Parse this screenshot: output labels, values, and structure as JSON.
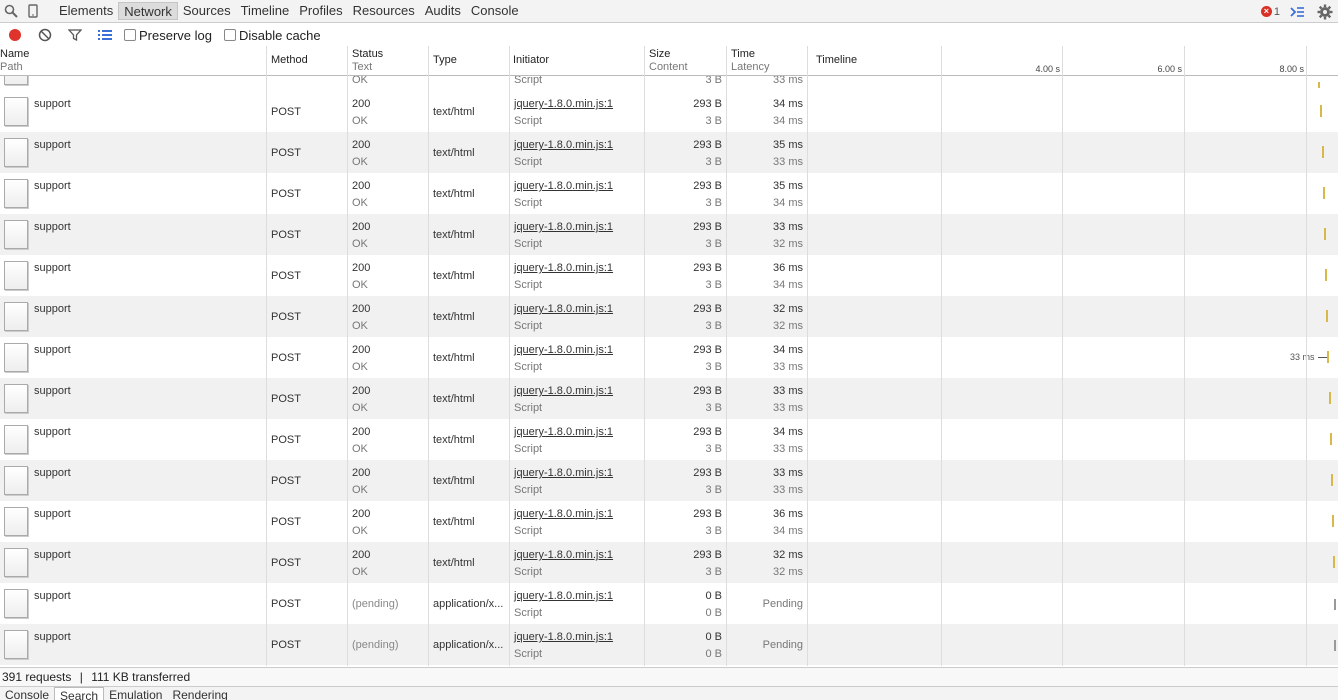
{
  "tabs": [
    "Elements",
    "Network",
    "Sources",
    "Timeline",
    "Profiles",
    "Resources",
    "Audits",
    "Console"
  ],
  "active_tab": "Network",
  "error_count": "1",
  "toolbar": {
    "preserve_log": "Preserve log",
    "disable_cache": "Disable cache"
  },
  "columns": {
    "name": "Name",
    "path": "Path",
    "method": "Method",
    "status": "Status",
    "text": "Text",
    "type": "Type",
    "initiator": "Initiator",
    "size": "Size",
    "content": "Content",
    "time": "Time",
    "latency": "Latency",
    "timeline": "Timeline"
  },
  "timeline_ticks": [
    "4.00 s",
    "6.00 s",
    "8.00 s"
  ],
  "partial_row": {
    "status_text": "OK",
    "initiator_type": "Script",
    "content": "3 B",
    "latency": "33 ms"
  },
  "rows": [
    {
      "name": "support",
      "method": "POST",
      "status": "200",
      "text": "OK",
      "type": "text/html",
      "initiator": "jquery-1.8.0.min.js:1",
      "init_type": "Script",
      "size": "293 B",
      "content": "3 B",
      "time": "34 ms",
      "latency": "34 ms",
      "bar": 1320
    },
    {
      "name": "support",
      "method": "POST",
      "status": "200",
      "text": "OK",
      "type": "text/html",
      "initiator": "jquery-1.8.0.min.js:1",
      "init_type": "Script",
      "size": "293 B",
      "content": "3 B",
      "time": "35 ms",
      "latency": "33 ms",
      "bar": 1322
    },
    {
      "name": "support",
      "method": "POST",
      "status": "200",
      "text": "OK",
      "type": "text/html",
      "initiator": "jquery-1.8.0.min.js:1",
      "init_type": "Script",
      "size": "293 B",
      "content": "3 B",
      "time": "35 ms",
      "latency": "34 ms",
      "bar": 1323
    },
    {
      "name": "support",
      "method": "POST",
      "status": "200",
      "text": "OK",
      "type": "text/html",
      "initiator": "jquery-1.8.0.min.js:1",
      "init_type": "Script",
      "size": "293 B",
      "content": "3 B",
      "time": "33 ms",
      "latency": "32 ms",
      "bar": 1324
    },
    {
      "name": "support",
      "method": "POST",
      "status": "200",
      "text": "OK",
      "type": "text/html",
      "initiator": "jquery-1.8.0.min.js:1",
      "init_type": "Script",
      "size": "293 B",
      "content": "3 B",
      "time": "36 ms",
      "latency": "34 ms",
      "bar": 1325
    },
    {
      "name": "support",
      "method": "POST",
      "status": "200",
      "text": "OK",
      "type": "text/html",
      "initiator": "jquery-1.8.0.min.js:1",
      "init_type": "Script",
      "size": "293 B",
      "content": "3 B",
      "time": "32 ms",
      "latency": "32 ms",
      "bar": 1326
    },
    {
      "name": "support",
      "method": "POST",
      "status": "200",
      "text": "OK",
      "type": "text/html",
      "initiator": "jquery-1.8.0.min.js:1",
      "init_type": "Script",
      "size": "293 B",
      "content": "3 B",
      "time": "34 ms",
      "latency": "33 ms",
      "bar": 1327,
      "bar_label": "33 ms"
    },
    {
      "name": "support",
      "method": "POST",
      "status": "200",
      "text": "OK",
      "type": "text/html",
      "initiator": "jquery-1.8.0.min.js:1",
      "init_type": "Script",
      "size": "293 B",
      "content": "3 B",
      "time": "33 ms",
      "latency": "33 ms",
      "bar": 1329
    },
    {
      "name": "support",
      "method": "POST",
      "status": "200",
      "text": "OK",
      "type": "text/html",
      "initiator": "jquery-1.8.0.min.js:1",
      "init_type": "Script",
      "size": "293 B",
      "content": "3 B",
      "time": "34 ms",
      "latency": "33 ms",
      "bar": 1330
    },
    {
      "name": "support",
      "method": "POST",
      "status": "200",
      "text": "OK",
      "type": "text/html",
      "initiator": "jquery-1.8.0.min.js:1",
      "init_type": "Script",
      "size": "293 B",
      "content": "3 B",
      "time": "33 ms",
      "latency": "33 ms",
      "bar": 1331
    },
    {
      "name": "support",
      "method": "POST",
      "status": "200",
      "text": "OK",
      "type": "text/html",
      "initiator": "jquery-1.8.0.min.js:1",
      "init_type": "Script",
      "size": "293 B",
      "content": "3 B",
      "time": "36 ms",
      "latency": "34 ms",
      "bar": 1332
    },
    {
      "name": "support",
      "method": "POST",
      "status": "200",
      "text": "OK",
      "type": "text/html",
      "initiator": "jquery-1.8.0.min.js:1",
      "init_type": "Script",
      "size": "293 B",
      "content": "3 B",
      "time": "32 ms",
      "latency": "32 ms",
      "bar": 1333
    },
    {
      "name": "support",
      "method": "POST",
      "status": "(pending)",
      "text": "",
      "type": "application/x...",
      "initiator": "jquery-1.8.0.min.js:1",
      "init_type": "Script",
      "size": "0 B",
      "content": "0 B",
      "time": "",
      "latency": "Pending",
      "bar": 1334,
      "pending": true
    },
    {
      "name": "support",
      "method": "POST",
      "status": "(pending)",
      "text": "",
      "type": "application/x...",
      "initiator": "jquery-1.8.0.min.js:1",
      "init_type": "Script",
      "size": "0 B",
      "content": "0 B",
      "time": "",
      "latency": "Pending",
      "bar": 1334,
      "pending": true
    }
  ],
  "footer": {
    "requests": "391 requests",
    "separator": "|",
    "transferred": "111 KB transferred"
  },
  "drawer_tabs": [
    "Console",
    "Search",
    "Emulation",
    "Rendering"
  ],
  "drawer_active": "Search"
}
